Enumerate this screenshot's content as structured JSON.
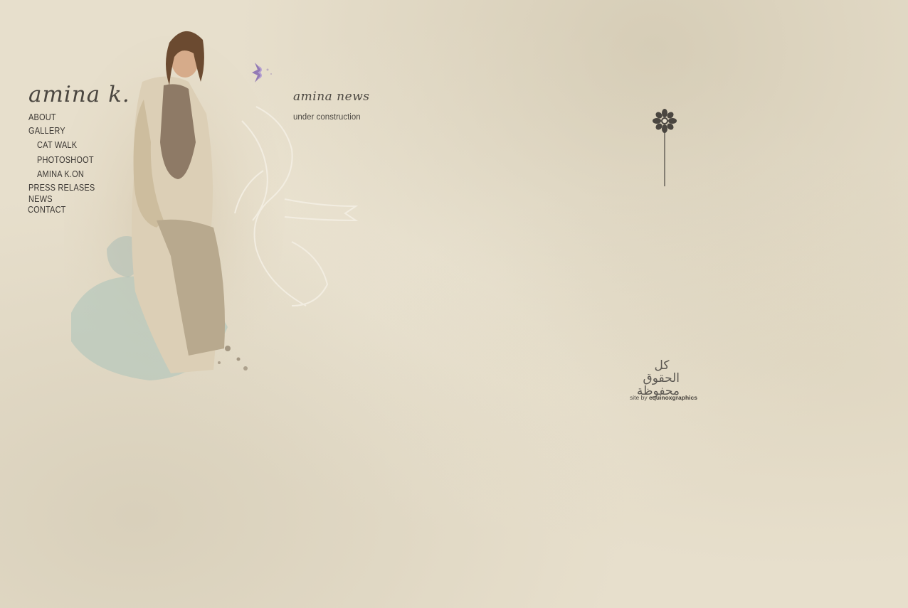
{
  "brand": {
    "logo": "amina k."
  },
  "nav": {
    "items": [
      {
        "label": "ABOUT"
      },
      {
        "label": "GALLERY"
      },
      {
        "label": "CAT WALK"
      },
      {
        "label": "PHOTOSHOOT"
      },
      {
        "label": "AMINA K.ON"
      },
      {
        "label": "PRESS RELASES"
      },
      {
        "label": "NEWS"
      },
      {
        "label": "CONTACT"
      }
    ]
  },
  "news": {
    "title": "amina news",
    "status": "under construction"
  },
  "footer": {
    "arabic_mark_line1": "كل الحقوق",
    "arabic_mark_line2": "محفوظة",
    "credit_prefix": "site by",
    "credit_brand": "equinoxgraphics"
  },
  "colors": {
    "background": "#e7dfcc",
    "text": "#3b3733",
    "accent_purple": "#7a5fa0"
  },
  "icons": [
    "purple-star-icon",
    "flower-ornament-icon",
    "calligraphy-swirl-icon"
  ]
}
